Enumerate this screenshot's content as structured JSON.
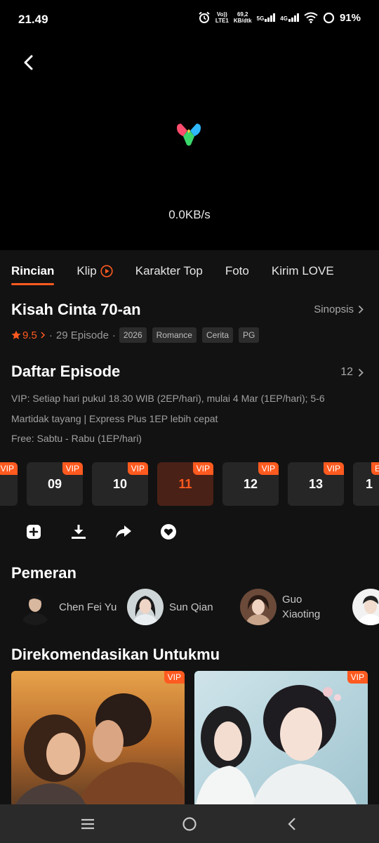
{
  "status": {
    "time": "21.49",
    "volte": "Vo))",
    "lte": "LTE1",
    "speed_value": "69,2",
    "speed_unit": "KB/dtk",
    "net1": "5G",
    "net2": "4G",
    "battery": "91%"
  },
  "player": {
    "speed": "0.0KB/s"
  },
  "tabs": [
    {
      "label": "Rincian"
    },
    {
      "label": "Klip"
    },
    {
      "label": "Karakter Top"
    },
    {
      "label": "Foto"
    },
    {
      "label": "Kirim LOVE"
    }
  ],
  "drama": {
    "title": "Kisah Cinta 70-an",
    "synopsis_label": "Sinopsis",
    "rating": "9.5",
    "episodes": "29 Episode",
    "tags": [
      "2026",
      "Romance",
      "Cerita",
      "PG"
    ]
  },
  "episode_list": {
    "title": "Daftar Episode",
    "count": "12",
    "schedule_line1": "VIP: Setiap hari pukul 18.30 WIB (2EP/hari), mulai 4 Mar (1EP/hari); 5-6",
    "schedule_line2": "Martidak tayang | Express Plus 1EP lebih cepat",
    "schedule_line3": "Free: Sabtu - Rabu (1EP/hari)",
    "items": [
      {
        "number": "",
        "badge": "VIP"
      },
      {
        "number": "09",
        "badge": "VIP"
      },
      {
        "number": "10",
        "badge": "VIP"
      },
      {
        "number": "11",
        "badge": "VIP"
      },
      {
        "number": "12",
        "badge": "VIP"
      },
      {
        "number": "13",
        "badge": "VIP"
      },
      {
        "number": "1",
        "badge": "E"
      }
    ]
  },
  "actions": [
    "add-icon",
    "download-icon",
    "share-icon",
    "favorite-icon"
  ],
  "cast": {
    "title": "Pemeran",
    "members": [
      {
        "name": "Chen Fei Yu"
      },
      {
        "name": "Sun Qian"
      },
      {
        "name_line1": "Guo",
        "name_line2": "Xiaoting"
      }
    ]
  },
  "recommendations": {
    "title": "Direkomendasikan Untukmu",
    "items": [
      {
        "badge": "VIP"
      },
      {
        "badge": "VIP"
      }
    ]
  },
  "colors": {
    "accent": "#ff5a1f",
    "background": "#121212",
    "player": "#000000"
  }
}
